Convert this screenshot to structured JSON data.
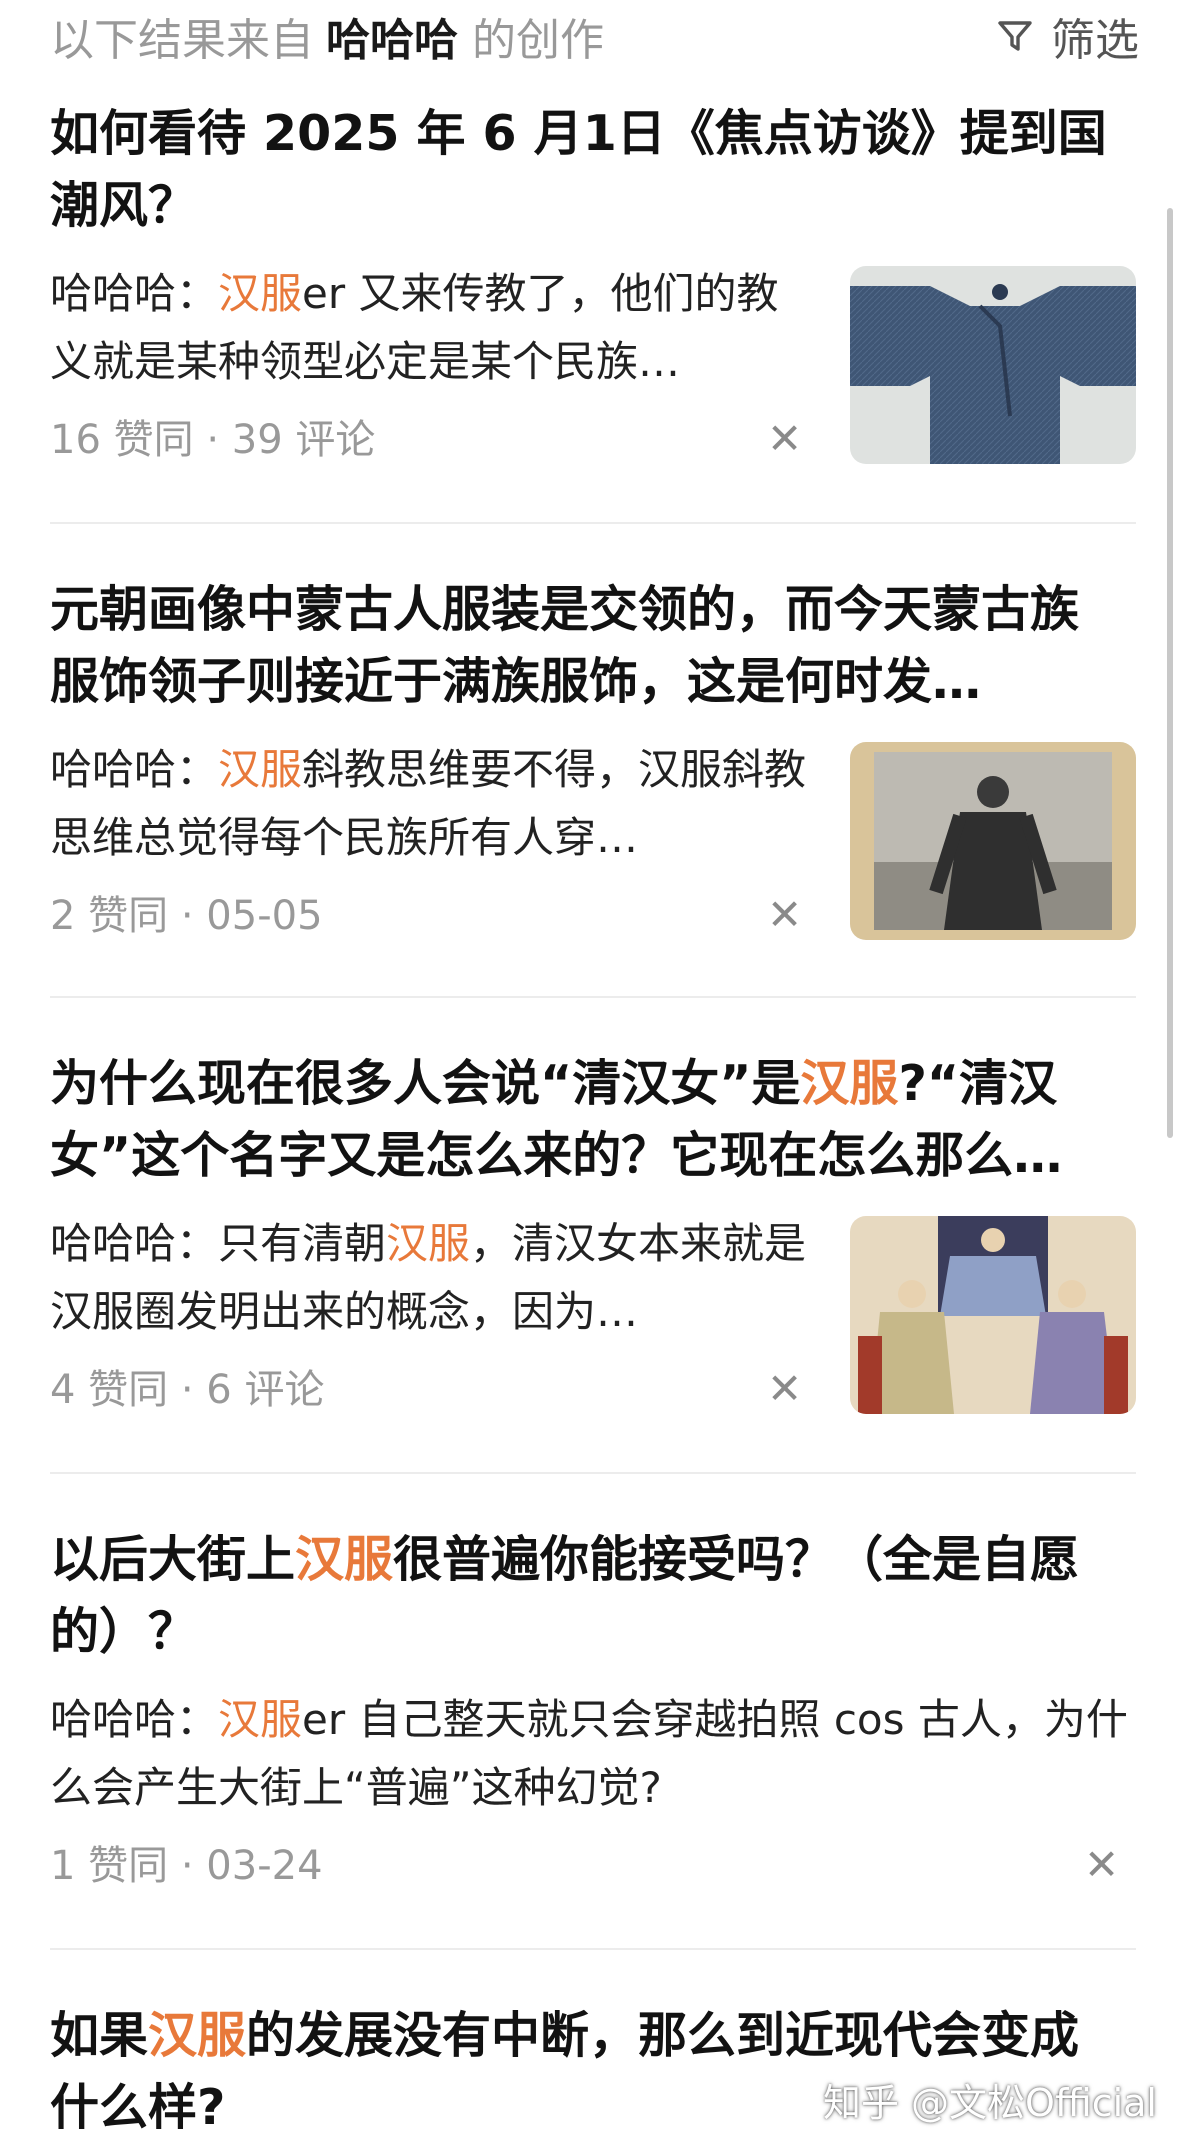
{
  "header": {
    "prefix": "以下结果来自",
    "author": "哈哈哈",
    "suffix": "的创作",
    "filter_label": "筛选"
  },
  "cards": [
    {
      "title": "如何看待 2025 年 6 月1日《焦点访谈》提到国潮风？",
      "excerpt_author": "哈哈哈：",
      "excerpt_highlight": "汉服",
      "excerpt_rest": "er 又来传教了，他们的教义就是某种领型必定是某个民族…",
      "meta": "16 赞同 · 39 评论",
      "thumbnail": "blue-robe-photo"
    },
    {
      "title": "元朝画像中蒙古人服装是交领的，而今天蒙古族服饰领子则接近于满族服饰，这是何时发…",
      "excerpt_author": "哈哈哈：",
      "excerpt_highlight": "汉服",
      "excerpt_rest": "斜教思维要不得，汉服斜教思维总觉得每个民族所有人穿…",
      "meta": "2 赞同 · 05-05",
      "thumbnail": "historical-man-photo"
    },
    {
      "title_part1": "为什么现在很多人会说“清汉女”是",
      "title_highlight": "汉服",
      "title_part2": "?“清汉女”这个名字又是怎么来的？它现在怎么那么…",
      "excerpt_author": "哈哈哈：只有清朝",
      "excerpt_highlight": "汉服",
      "excerpt_rest": "，清汉女本来就是汉服圈发明出来的概念，因为…",
      "meta": "4 赞同 · 6 评论",
      "thumbnail": "qing-portrait-painting"
    },
    {
      "title_part1": "以后大街上",
      "title_highlight": "汉服",
      "title_part2": "很普遍你能接受吗？（全是自愿的）？",
      "excerpt_author": "哈哈哈：",
      "excerpt_highlight": "汉服",
      "excerpt_rest": "er 自己整天就只会穿越拍照 cos 古人，为什么会产生大街上“普遍”这种幻觉?",
      "meta": "1 赞同 · 03-24"
    },
    {
      "title_part1": "如果",
      "title_highlight": "汉服",
      "title_part2": "的发展没有中断，那么到近现代会变成什么样?"
    }
  ],
  "watermark": "知乎 @文松Official",
  "colors": {
    "highlight": "#e8793a",
    "meta": "#999999",
    "title": "#121212"
  }
}
